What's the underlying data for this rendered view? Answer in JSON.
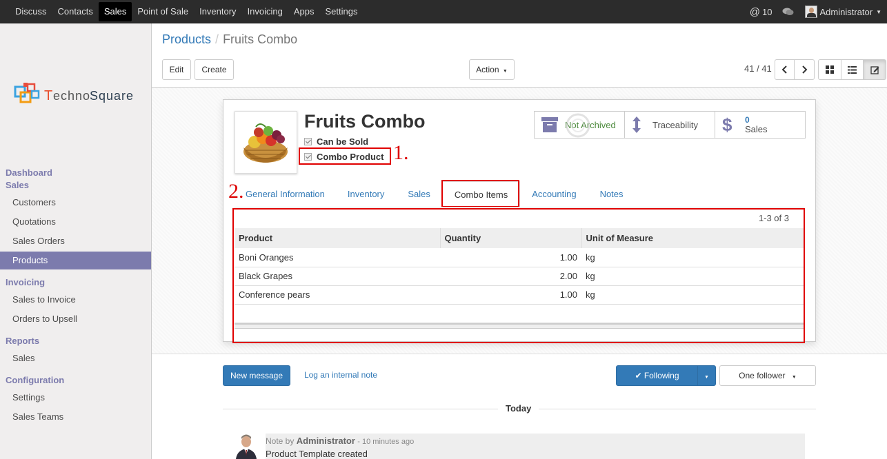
{
  "topbar": {
    "menu": [
      "Discuss",
      "Contacts",
      "Sales",
      "Point of Sale",
      "Inventory",
      "Invoicing",
      "Apps",
      "Settings"
    ],
    "active_menu": "Sales",
    "mentions": "10",
    "user": "Administrator"
  },
  "sidebar": {
    "logo_text": "TechnoSquare",
    "sections": [
      {
        "title": "Dashboard"
      },
      {
        "title": "Sales",
        "items": [
          "Customers",
          "Quotations",
          "Sales Orders",
          "Products"
        ]
      },
      {
        "title": "Invoicing",
        "items": [
          "Sales to Invoice",
          "Orders to Upsell"
        ]
      },
      {
        "title": "Reports",
        "items": [
          "Sales"
        ]
      },
      {
        "title": "Configuration",
        "items": [
          "Settings",
          "Sales Teams"
        ]
      }
    ],
    "active_item": "Products"
  },
  "breadcrumb": {
    "parent": "Products",
    "current": "Fruits Combo"
  },
  "buttons": {
    "edit": "Edit",
    "create": "Create",
    "action": "Action"
  },
  "pager": {
    "value": "41 / 41"
  },
  "product": {
    "name": "Fruits Combo",
    "can_be_sold": "Can be Sold",
    "combo_product": "Combo Product"
  },
  "annotations": {
    "one": "1.",
    "two": "2."
  },
  "stats": {
    "archive": "Not Archived",
    "traceability": "Traceability",
    "sales_count": "0",
    "sales_label": "Sales"
  },
  "tabs": [
    "General Information",
    "Inventory",
    "Sales",
    "Combo Items",
    "Accounting",
    "Notes"
  ],
  "active_tab": "Combo Items",
  "combo_list": {
    "pager": "1-3 of 3",
    "columns": [
      "Product",
      "Quantity",
      "Unit of Measure"
    ],
    "rows": [
      {
        "product": "Boni Oranges",
        "quantity": "1.00",
        "uom": "kg"
      },
      {
        "product": "Black Grapes",
        "quantity": "2.00",
        "uom": "kg"
      },
      {
        "product": "Conference pears",
        "quantity": "1.00",
        "uom": "kg"
      }
    ]
  },
  "chatter": {
    "new_message": "New message",
    "log_note": "Log an internal note",
    "following": "Following",
    "followers": "One follower",
    "today": "Today",
    "message": {
      "prefix": "Note by",
      "author": "Administrator",
      "time": "- 10 minutes ago",
      "body": "Product Template created"
    }
  },
  "colors": {
    "primary": "#337ab7",
    "sidebar_active": "#7c7bad",
    "annotation": "#e00000"
  }
}
